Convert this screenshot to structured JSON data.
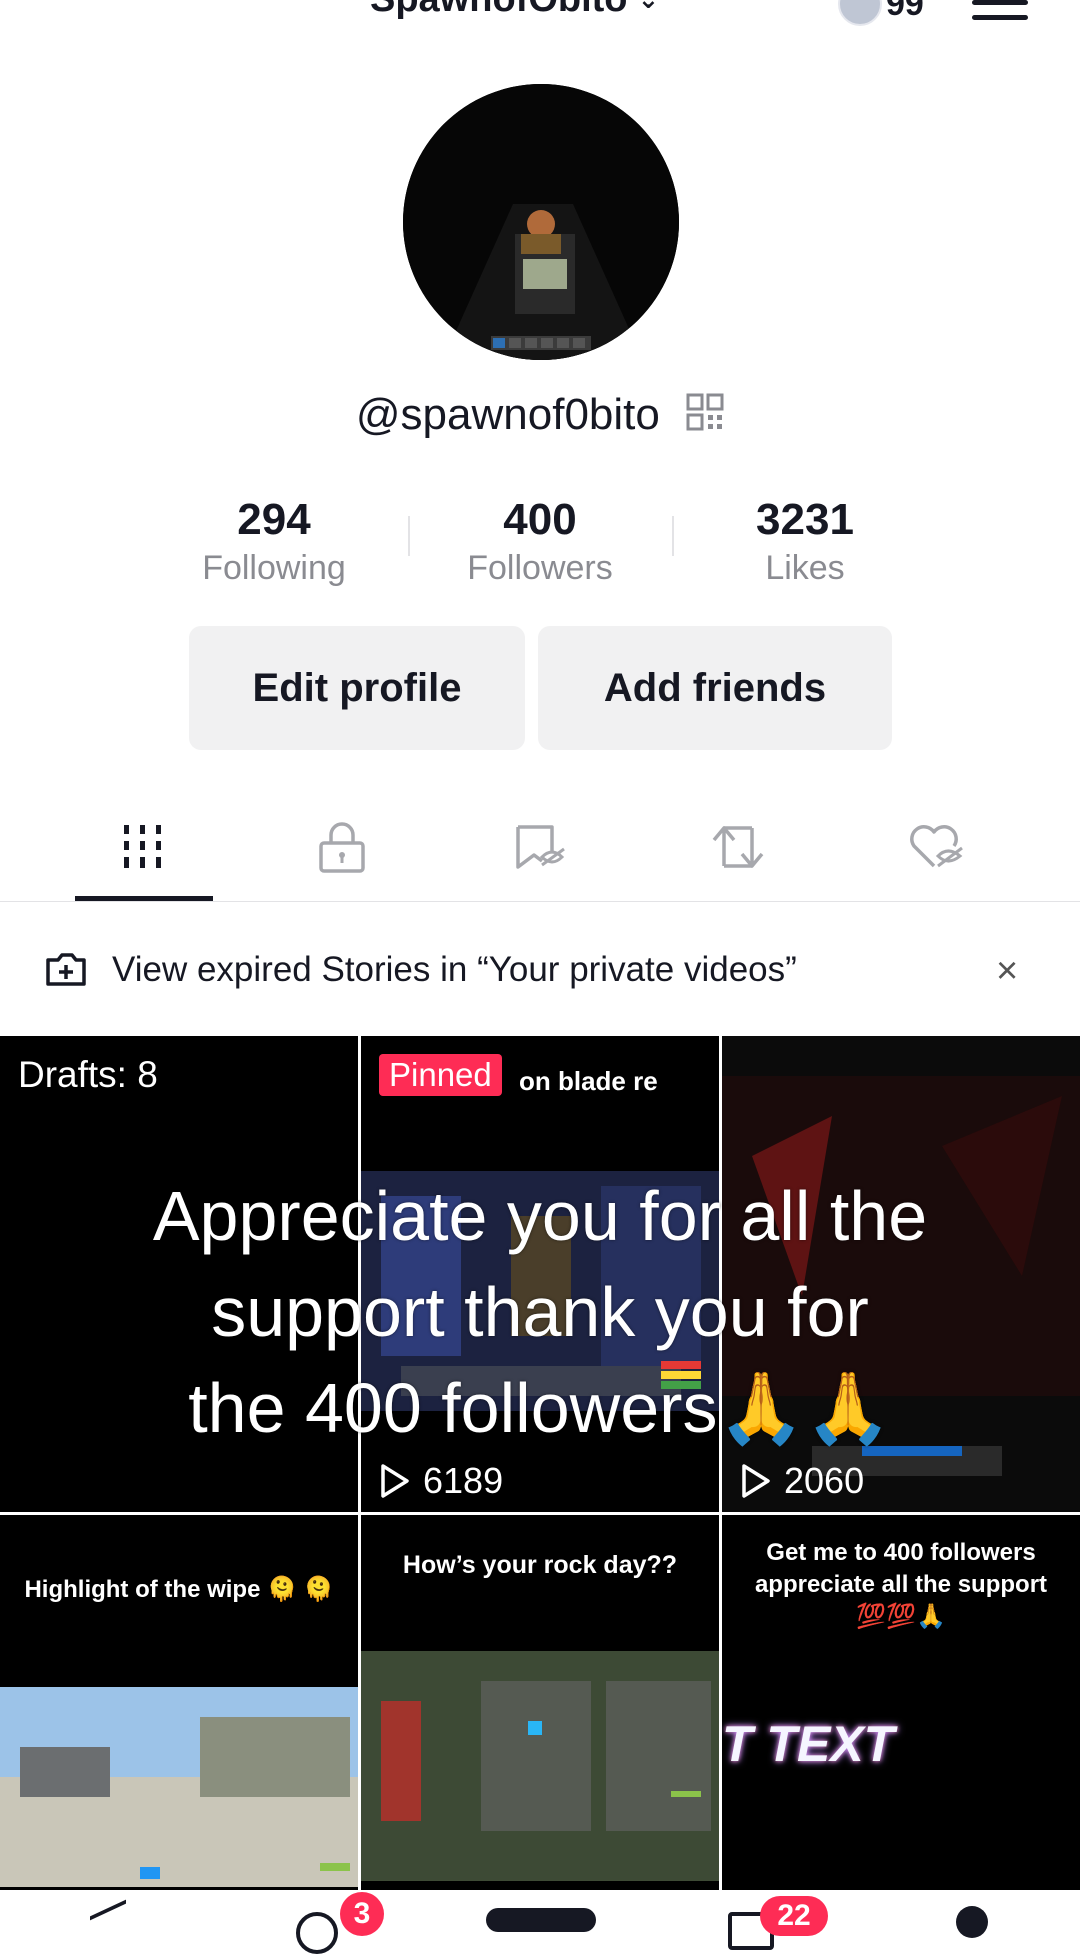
{
  "header": {
    "username": "SpawnofObito",
    "notification_count": "99"
  },
  "profile": {
    "handle": "@spawnof0bito",
    "stats": [
      {
        "value": "294",
        "label": "Following"
      },
      {
        "value": "400",
        "label": "Followers"
      },
      {
        "value": "3231",
        "label": "Likes"
      }
    ],
    "edit_button": "Edit profile",
    "add_friends_button": "Add friends"
  },
  "tabs": [
    {
      "icon": "videos-grid-icon",
      "active": true
    },
    {
      "icon": "lock-icon",
      "active": false
    },
    {
      "icon": "saved-hidden-icon",
      "active": false
    },
    {
      "icon": "repost-icon",
      "active": false
    },
    {
      "icon": "liked-hidden-icon",
      "active": false
    }
  ],
  "banner": {
    "text": "View expired Stories in “Your private videos”",
    "close": "×"
  },
  "grid": {
    "drafts_label": "Drafts: 8",
    "pinned_badge": "Pinned",
    "pinned_caption": "on blade re",
    "views": [
      "6189",
      "2060"
    ],
    "tile_captions": {
      "highlight": "Highlight of the wipe 🫠 🫠",
      "rock_day": "How’s your rock day??",
      "get_me": "Get me to 400 followers appreciate all the support 💯💯🙏",
      "text_art": "T TEXT"
    }
  },
  "overlay_caption": {
    "line1": "Appreciate you for all the",
    "line2": "support thank you for",
    "line3": "the 400 followers🙏🙏"
  },
  "bottom_nav": {
    "inbox_badge": "3",
    "messages_badge": "22"
  },
  "colors": {
    "accent": "#fe2c55",
    "text_primary": "#161823",
    "text_secondary": "#8a8b91",
    "button_bg": "#f1f1f2"
  }
}
